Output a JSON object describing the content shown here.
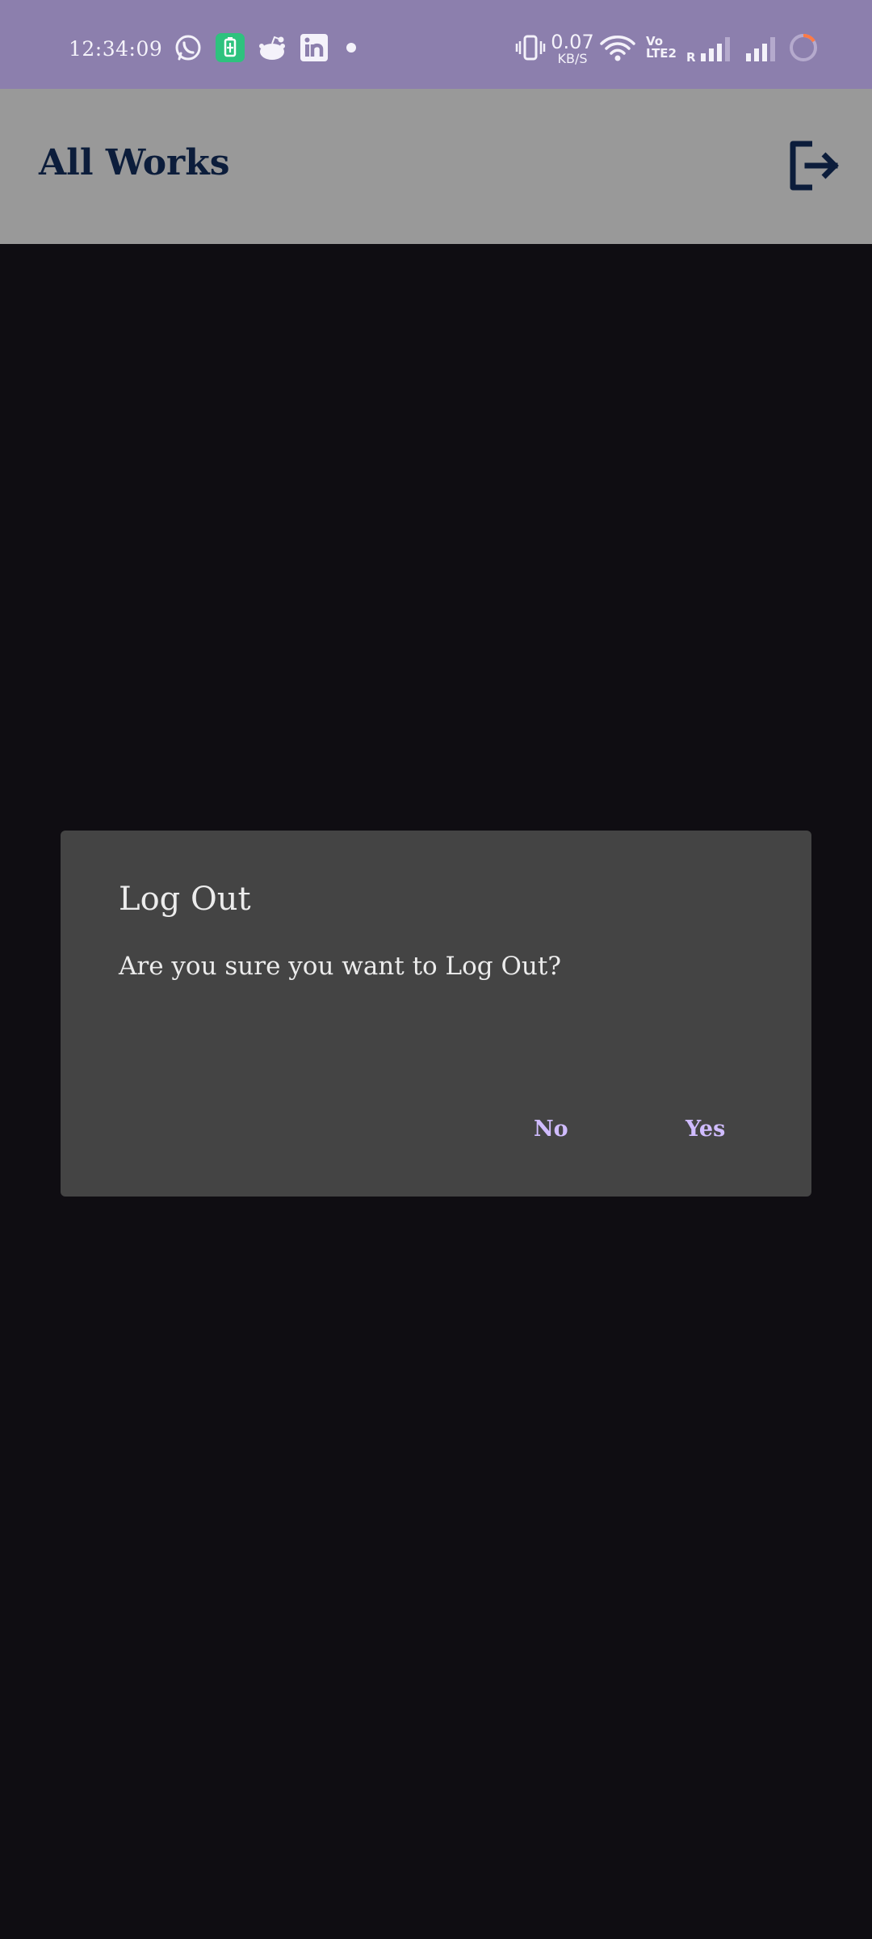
{
  "status_bar": {
    "time": "12:34:09",
    "net_speed_value": "0.07",
    "net_speed_unit": "KB/S",
    "volte_label": "Vo\nLTE2",
    "roaming_label": "R",
    "notification_icons": [
      "whatsapp-icon",
      "battery-saver-icon",
      "reddit-icon",
      "linkedin-icon",
      "dot-icon"
    ],
    "system_icons": [
      "vibrate-icon",
      "wifi-icon",
      "signal-icon",
      "signal-icon",
      "loading-ring-icon"
    ]
  },
  "app_bar": {
    "title": "All Works",
    "action_icon": "logout-icon"
  },
  "dialog": {
    "title": "Log Out",
    "message": "Are you sure you want to Log Out?",
    "negative_label": "No",
    "positive_label": "Yes"
  },
  "colors": {
    "status_bar": "#8c7fad",
    "app_bar": "#999999",
    "title_text": "#0c1d3b",
    "background": "#0f0d12",
    "dialog_surface": "#444444",
    "dialog_text": "#ececec",
    "dialog_action": "#d0bcff",
    "battery_saver": "#2ec27e"
  }
}
